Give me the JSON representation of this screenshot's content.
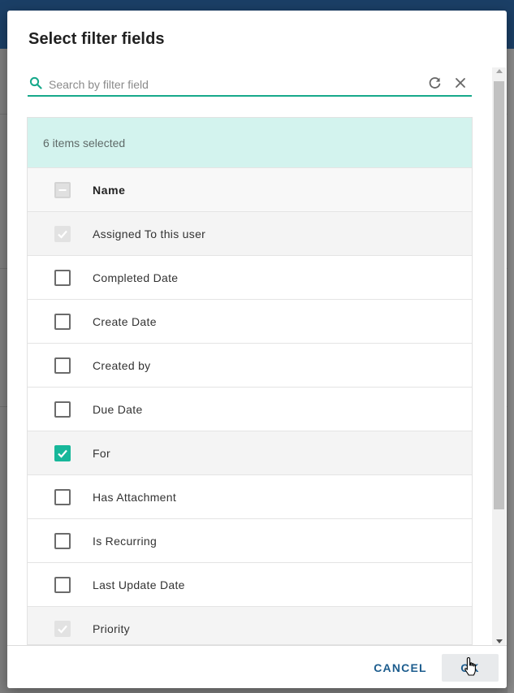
{
  "dialog": {
    "title": "Select filter fields"
  },
  "search": {
    "placeholder": "Search by filter field",
    "value": ""
  },
  "selection": {
    "summary": "6 items selected"
  },
  "list": {
    "header": {
      "label": "Name",
      "state": "indeterminate"
    },
    "items": [
      {
        "label": "Assigned To this user",
        "state": "checked-disabled"
      },
      {
        "label": "Completed Date",
        "state": "unchecked"
      },
      {
        "label": "Create Date",
        "state": "unchecked"
      },
      {
        "label": "Created by",
        "state": "unchecked"
      },
      {
        "label": "Due Date",
        "state": "unchecked"
      },
      {
        "label": "For",
        "state": "checked"
      },
      {
        "label": "Has Attachment",
        "state": "unchecked"
      },
      {
        "label": "Is Recurring",
        "state": "unchecked"
      },
      {
        "label": "Last Update Date",
        "state": "unchecked"
      },
      {
        "label": "Priority",
        "state": "checked-disabled"
      }
    ]
  },
  "footer": {
    "cancel_label": "CANCEL",
    "ok_label": "OK"
  },
  "colors": {
    "accent": "#17b79a",
    "banner": "#d3f3ee",
    "button_text": "#1d5d8e"
  }
}
